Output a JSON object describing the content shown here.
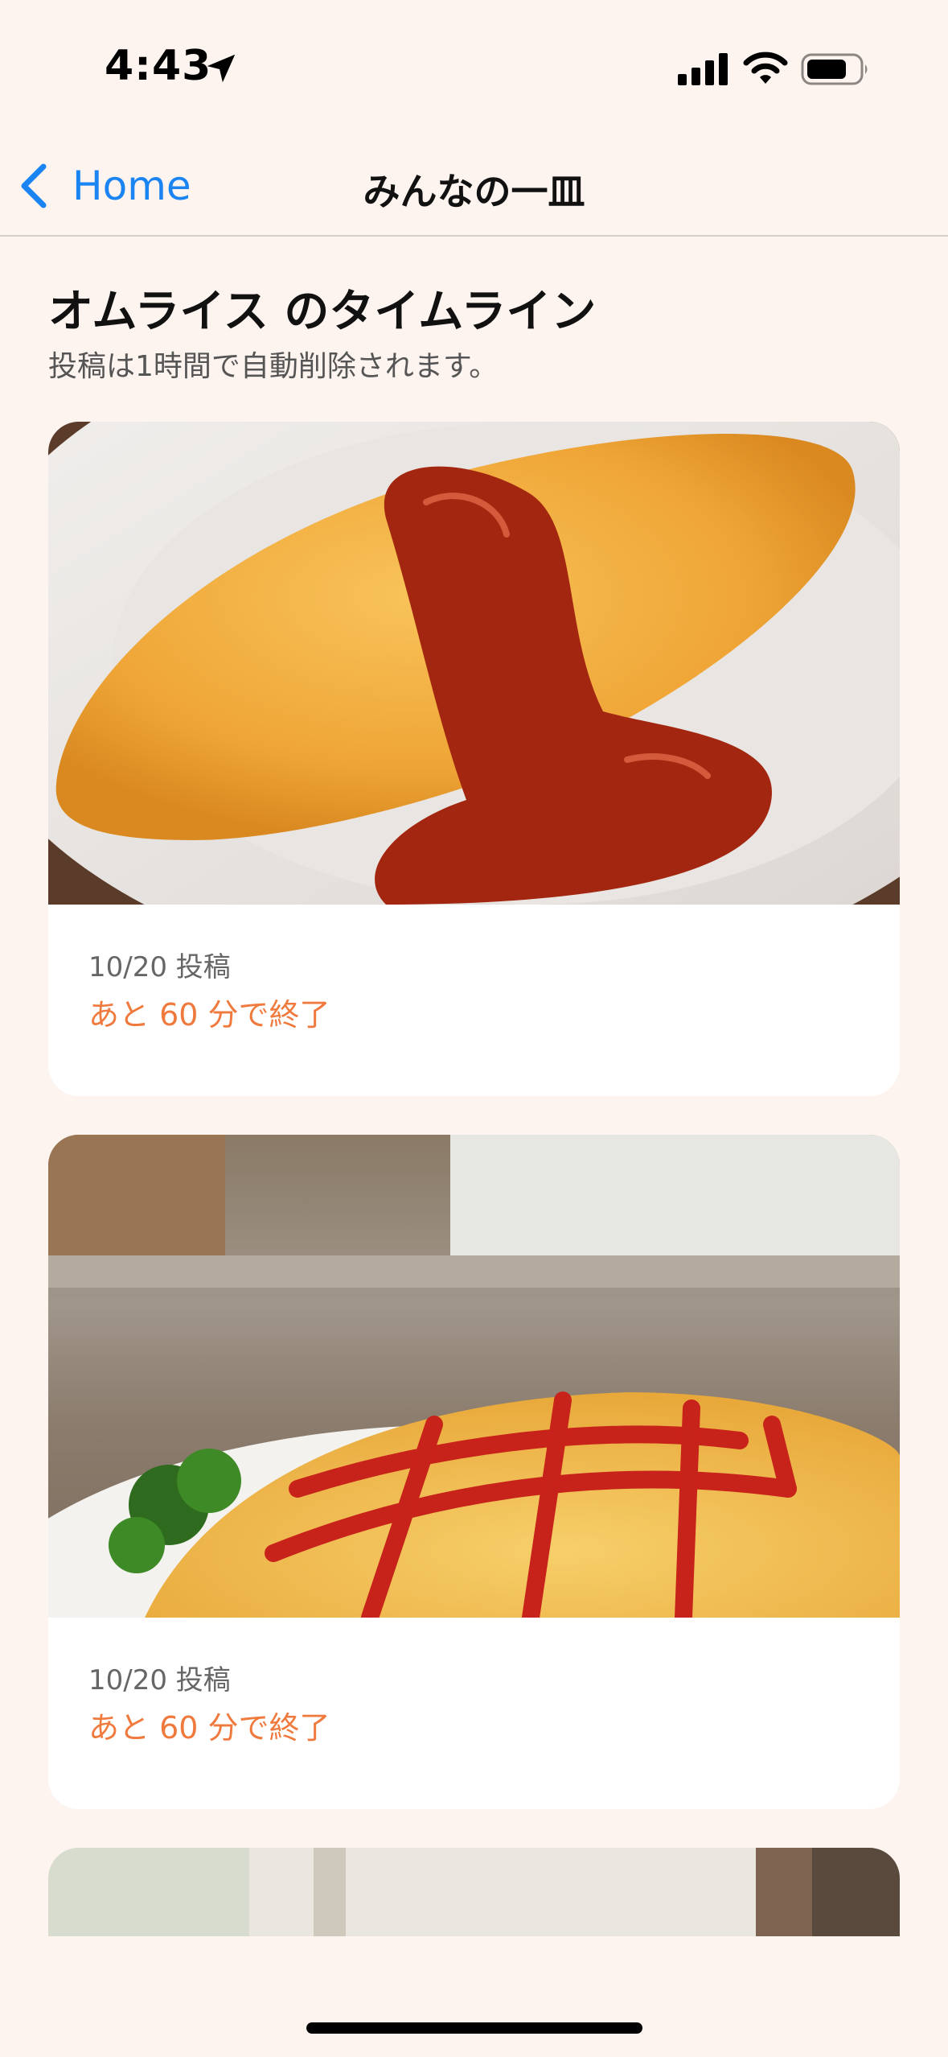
{
  "status_bar": {
    "time": "4:43"
  },
  "nav": {
    "back_label": "Home",
    "title": "みんなの一皿"
  },
  "header": {
    "title": "オムライス のタイムライン",
    "subtitle": "投稿は1時間で自動削除されます。"
  },
  "posts": [
    {
      "date": "10/20 投稿",
      "remaining": "あと 60 分で終了"
    },
    {
      "date": "10/20 投稿",
      "remaining": "あと 60 分で終了"
    }
  ],
  "colors": {
    "accent": "#1A84F3",
    "countdown": "#F07A3E",
    "background": "#FDF4EF"
  },
  "icons": [
    "location-arrow-icon",
    "cellular-signal-icon",
    "wifi-icon",
    "battery-icon",
    "chevron-left-icon"
  ]
}
